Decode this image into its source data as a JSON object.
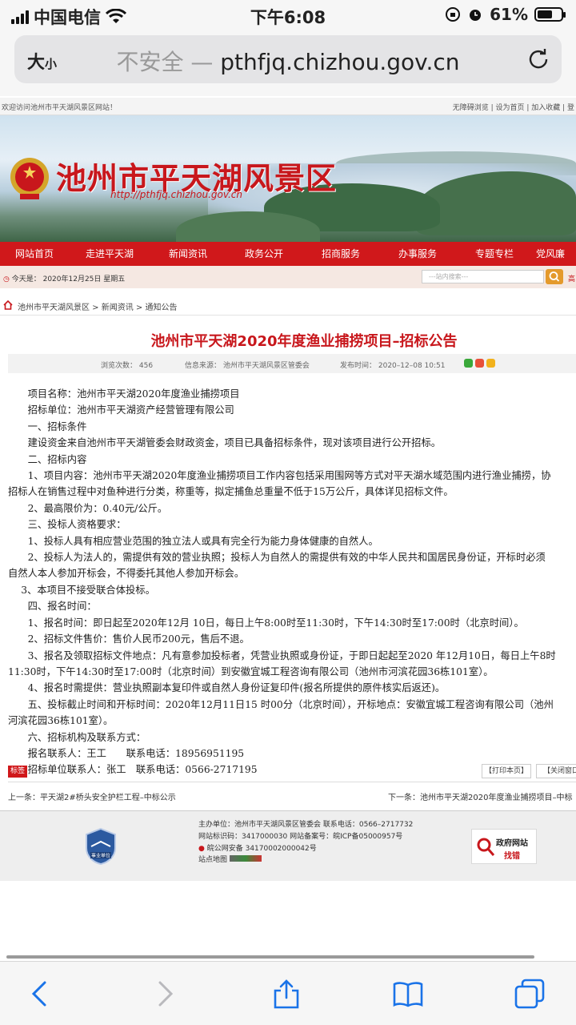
{
  "status_bar": {
    "carrier": "中国电信",
    "time": "下午6:08",
    "battery": "61%"
  },
  "browser": {
    "text_size_label": "大",
    "text_size_small": "小",
    "insecure_label": "不安全",
    "separator": " — ",
    "url": "pthfjq.chizhou.gov.cn"
  },
  "site": {
    "welcome": "欢迎访问池州市平天湖风景区网站！",
    "top_links": "无障碍浏览 | 设为首页 | 加入收藏 | 登",
    "banner_title": "池州市平天湖风景区",
    "banner_url": "http://pthfjq.chizhou.gov.cn",
    "nav": [
      "网站首页",
      "走进平天湖",
      "新闻资讯",
      "政务公开",
      "招商服务",
      "办事服务",
      "专题专栏",
      "党风廉"
    ],
    "today": "今天是：  2020年12月25日  星期五",
    "search_placeholder": "---站内搜索---",
    "search_more": "高",
    "breadcrumb": "池州市平天湖风景区  >  新闻资讯  >  通知公告"
  },
  "article": {
    "title": "池州市平天湖2020年度渔业捕捞项目–招标公告",
    "views": "浏览次数：    456",
    "source": "信息来源：  池州市平天湖风景区管委会",
    "publish_time": "发布时间：  2020–12–08 10:51",
    "body": [
      "　　项目名称：池州市平天湖2020年度渔业捕捞项目",
      "　　招标单位：池州市平天湖资产经营管理有限公司",
      "　　一、招标条件",
      "　　建设资金来自池州市平天湖管委会财政资金，项目已具备招标条件，现对该项目进行公开招标。",
      "　　二、招标内容",
      "　　1、项目内容：池州市平天湖2020年度渔业捕捞项目工作内容包括采用围网等方式对平天湖水域范围内进行渔业捕捞，协",
      "招标人在销售过程中对鱼种进行分类，称重等，拟定捕鱼总重量不低于15万公斤，具体详见招标文件。",
      "　　2、最高限价为：0.40元/公斤。",
      "　　三、投标人资格要求：",
      "　　1、投标人具有相应营业范围的独立法人或具有完全行为能力身体健康的自然人。",
      "　　2、投标人为法人的，需提供有效的营业执照；投标人为自然人的需提供有效的中华人民共和国居民身份证，开标时必须",
      "自然人本人参加开标会，不得委托其他人参加开标会。",
      "　 3、本项目不接受联合体投标。",
      "　　四、报名时间：",
      "　　1、报名时间：即日起至2020年12月 10日，每日上午8:00时至11:30时，下午14:30时至17:00时（北京时间）。",
      "　　2、招标文件售价：售价人民币200元，售后不退。",
      "　　3、报名及领取招标文件地点：凡有意参加投标者，凭营业执照或身份证，于即日起起至2020 年12月10日，每日上午8时",
      "11:30时，下午14:30时至17:00时（北京时间）到安徽宜城工程咨询有限公司（池州市河滨花园36栋101室）。",
      "　　4、报名时需提供：营业执照副本复印件或自然人身份证复印件(报名所提供的原件核实后返还)。",
      "　　五、投标截止时间和开标时间：2020年12月11日15 时00分（北京时间），开标地点：安徽宜城工程咨询有限公司（池州",
      "河滨花园36栋101室）。",
      "　　六、招标机构及联系方式：",
      "　　报名联系人：王工　　联系电话：18956951195",
      "　　招标单位联系人：张工　联系电话：0566-2717195"
    ],
    "tag_label": "标签",
    "print_label": "【打印本页】",
    "close_label": "【关闭窗口",
    "prev": "上一条：平天湖2#桥头安全护栏工程–中标公示",
    "next": "下一条：池州市平天湖2020年度渔业捕捞项目–中标"
  },
  "footer": {
    "host": "主办单位：池州市平天湖风景区管委会  联系电话：0566–2717732",
    "site_id": "网站标识码：3417000030  网站备案号：皖ICP备05000957号",
    "police": "皖公网安备 34170002000042号",
    "sitemap": "站点地图",
    "badge_text": "事业单位",
    "gov_site": "政府网站",
    "find_error": "找错"
  },
  "colors": {
    "accent_red": "#d0181b",
    "link_red": "#c8171c",
    "ios_blue": "#1a73e8"
  }
}
